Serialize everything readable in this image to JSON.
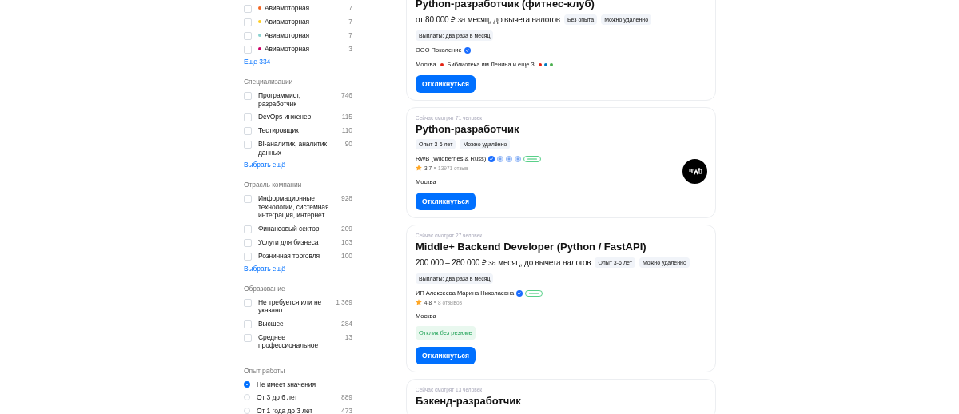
{
  "filters": [
    {
      "items": [
        {
          "label": "Авиамоторная",
          "count": "7",
          "checked": false,
          "color": "#f26522"
        },
        {
          "label": "Авиамоторная",
          "count": "7",
          "checked": false,
          "color": "#ffcd1c"
        },
        {
          "label": "Авиамоторная",
          "count": "7",
          "checked": false,
          "color": "#8ad1cf"
        },
        {
          "label": "Авиамоторная",
          "count": "3",
          "checked": false,
          "color": "#cc0066"
        }
      ],
      "more": "Еще 334"
    },
    {
      "title": "Специализации",
      "items": [
        {
          "label": "Программист, разработчик",
          "count": "746",
          "checked": false
        },
        {
          "label": "DevOps-инженер",
          "count": "115",
          "checked": false
        },
        {
          "label": "Тестировщик",
          "count": "110",
          "checked": false
        },
        {
          "label": "BI-аналитик, аналитик данных",
          "count": "90",
          "checked": false
        }
      ],
      "more": "Выбрать ещё"
    },
    {
      "title": "Отрасль компании",
      "items": [
        {
          "label": "Информационные технологии, системная интеграция, интернет",
          "count": "928",
          "checked": false
        },
        {
          "label": "Финансовый сектор",
          "count": "209",
          "checked": false
        },
        {
          "label": "Услуги для бизнеса",
          "count": "103",
          "checked": false
        },
        {
          "label": "Розничная торговля",
          "count": "100",
          "checked": false
        }
      ],
      "more": "Выбрать ещё"
    },
    {
      "title": "Образование",
      "items": [
        {
          "label": "Не требуется или не указано",
          "count": "1 369",
          "checked": false
        },
        {
          "label": "Высшее",
          "count": "284",
          "checked": false
        },
        {
          "label": "Среднее профессиональное",
          "count": "13",
          "checked": false
        }
      ]
    },
    {
      "title": "Опыт работы",
      "kind": "radio",
      "items": [
        {
          "label": "Не имеет значения",
          "selected": true
        },
        {
          "label": "От 3 до 6 лет",
          "count": "889",
          "selected": false
        },
        {
          "label": "От 1 года до 3 лет",
          "count": "473",
          "selected": false
        }
      ]
    }
  ],
  "vacancies": [
    {
      "title": "Python-разработчик (фитнес-клуб)",
      "salary": "от 80 000 ₽ за месяц, до вычета налогов",
      "tags": [
        "Без опыта",
        "Можно удалённо"
      ],
      "tags2": [
        "Выплаты: два раза в месяц"
      ],
      "company": "ООО Поколение",
      "company_marks": [
        {
          "kind": "verified"
        }
      ],
      "location": "Москва",
      "metro": {
        "station": "Библиотека им.Ленина и еще 3",
        "color": "#e42313",
        "more_lines": [
          {
            "color": "#e42313"
          },
          {
            "color": "#0078be"
          },
          {
            "color": "#4baf4f"
          }
        ]
      },
      "button": "Откликнуться"
    },
    {
      "viewers": "Сейчас смотрят 71 человек",
      "title": "Python-разработчик",
      "tags": [
        "Опыт 3-6 лет",
        "Можно удалённо"
      ],
      "company": "RWB (Wildberries & Russ)",
      "company_marks": [
        {
          "kind": "verified"
        },
        {
          "kind": "award"
        },
        {
          "kind": "award"
        },
        {
          "kind": "award"
        },
        {
          "kind": "online"
        }
      ],
      "rating": "3.7",
      "reviews": "13971 отзыв",
      "location": "Москва",
      "logo": {
        "kind": "rwb"
      },
      "button": "Откликнуться"
    },
    {
      "viewers": "Сейчас смотрят 27 человек",
      "title": "Middle+ Backend Developer (Python / FastAPI)",
      "salary": "200 000 – 280 000 ₽ за месяц, до вычета налогов",
      "tags": [
        "Опыт 3-6 лет",
        "Можно удалённо"
      ],
      "tags2": [
        "Выплаты: два раза в месяц"
      ],
      "company": "ИП Алексеева Марина Николаевна",
      "company_marks": [
        {
          "kind": "verified"
        },
        {
          "kind": "online"
        }
      ],
      "rating": "4.8",
      "reviews": "8 отзывов",
      "location": "Москва",
      "no_resume": "Отклик без резюме",
      "button": "Откликнуться"
    },
    {
      "viewers": "Сейчас смотрят 13 человек",
      "title": "Бэкенд-разработчик"
    }
  ]
}
